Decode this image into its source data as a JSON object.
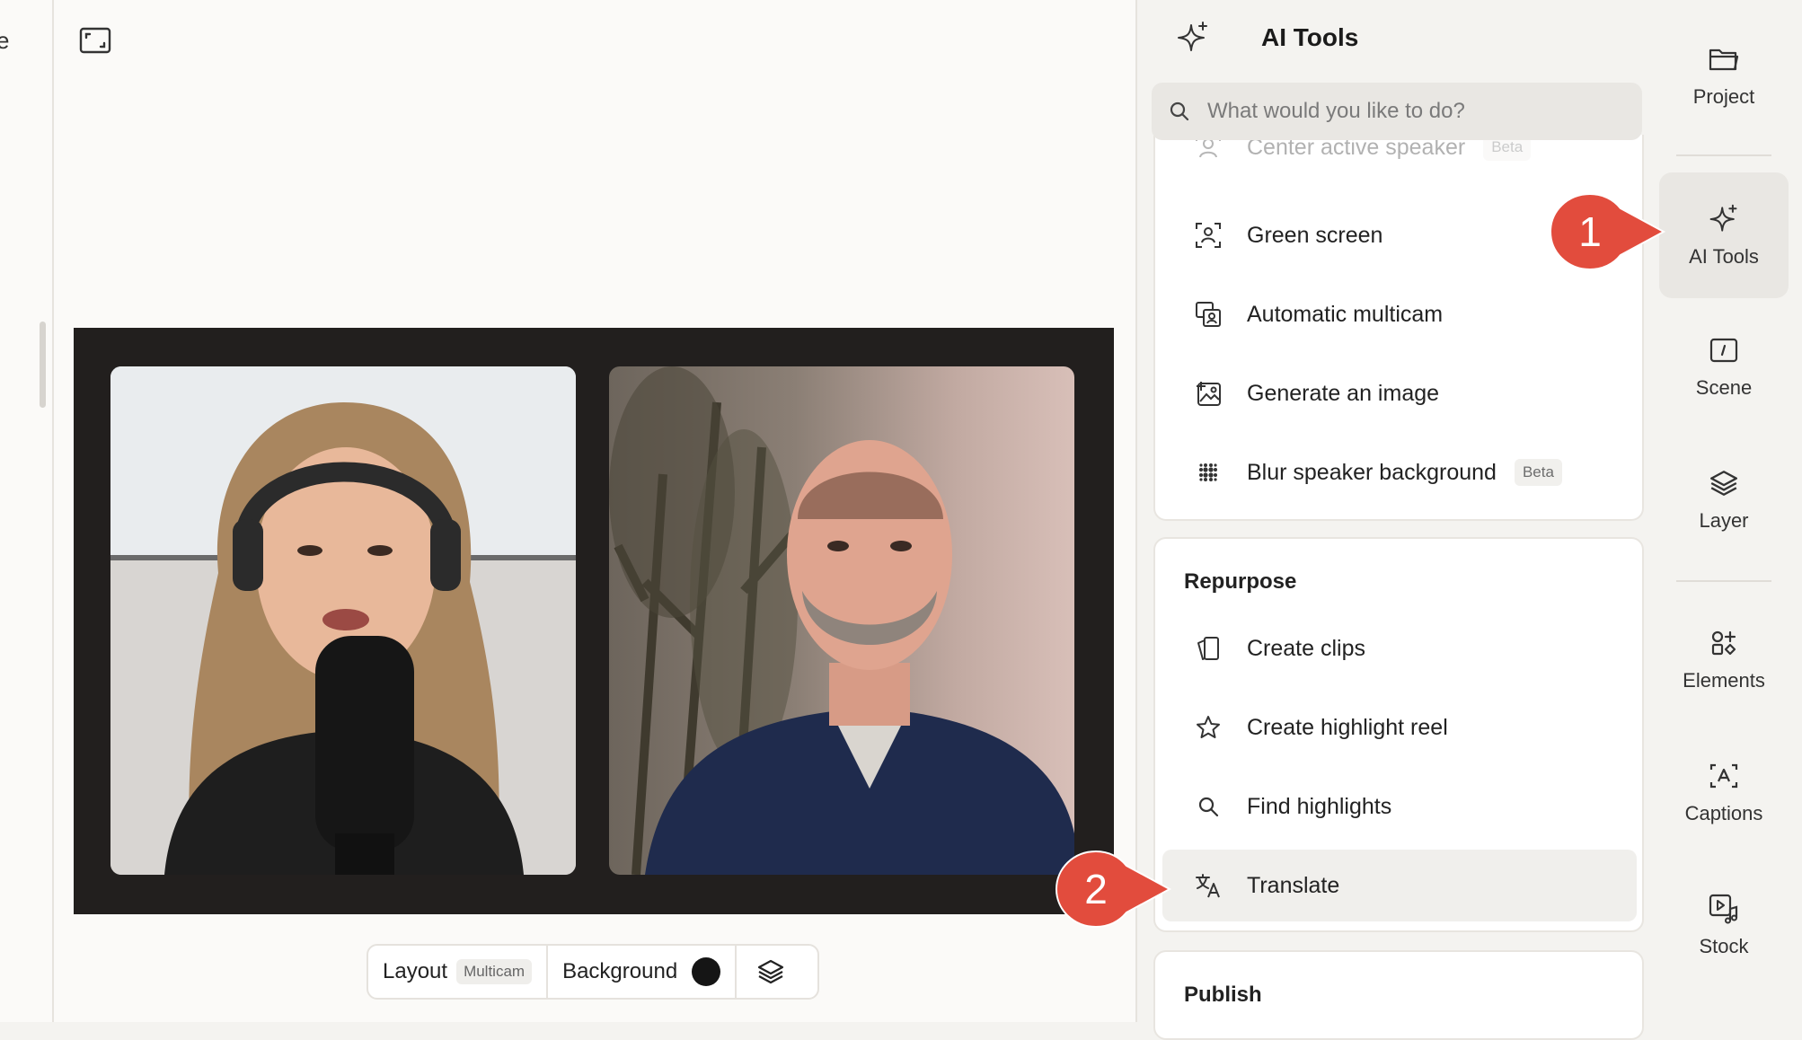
{
  "left_edge_text": "e",
  "canvas": {
    "layout_label": "Layout",
    "layout_value": "Multicam",
    "background_label": "Background",
    "background_color": "#151515"
  },
  "panel": {
    "title": "AI Tools",
    "search_placeholder": "What would you like to do?",
    "top_items": [
      {
        "label": "Center active speaker",
        "badge": "Beta",
        "icon": "speaker-focus-icon"
      },
      {
        "label": "Green screen",
        "icon": "green-screen-icon"
      },
      {
        "label": "Automatic multicam",
        "icon": "multicam-icon"
      },
      {
        "label": "Generate an image",
        "icon": "image-sparkle-icon"
      },
      {
        "label": "Blur speaker background",
        "badge": "Beta",
        "icon": "blur-icon"
      }
    ],
    "repurpose": {
      "heading": "Repurpose",
      "items": [
        {
          "label": "Create clips",
          "icon": "clips-icon"
        },
        {
          "label": "Create highlight reel",
          "icon": "star-icon"
        },
        {
          "label": "Find highlights",
          "icon": "search-icon"
        },
        {
          "label": "Translate",
          "icon": "translate-icon"
        }
      ]
    },
    "publish": {
      "heading": "Publish"
    }
  },
  "nav": [
    {
      "label": "Project",
      "icon": "folder-icon"
    },
    {
      "label": "AI Tools",
      "icon": "sparkle-icon",
      "selected": true
    },
    {
      "label": "Scene",
      "icon": "scene-icon"
    },
    {
      "label": "Layer",
      "icon": "layers-icon"
    },
    {
      "label": "Elements",
      "icon": "elements-icon"
    },
    {
      "label": "Captions",
      "icon": "captions-icon"
    },
    {
      "label": "Stock",
      "icon": "stock-icon"
    }
  ],
  "callouts": [
    {
      "number": "1",
      "color": "#e24c3d"
    },
    {
      "number": "2",
      "color": "#e24c3d"
    }
  ]
}
